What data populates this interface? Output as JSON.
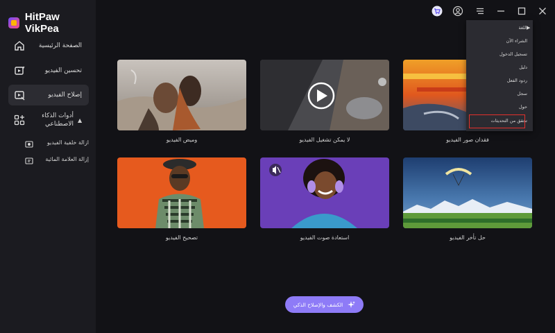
{
  "app": {
    "name": "HitPaw VikPea"
  },
  "sidebar": {
    "items": [
      {
        "label": "الصفحة الرئيسية",
        "icon": "home-icon"
      },
      {
        "label": "تحسين الفيديو",
        "icon": "video-enhance-icon"
      },
      {
        "label": "إصلاح الفيديو",
        "icon": "video-repair-icon"
      },
      {
        "label": "أدوات الذكاء الاصطناعي",
        "icon": "ai-tools-icon"
      }
    ],
    "subitems": [
      {
        "label": "ازالة خلفية الفيديو",
        "icon": "remove-background-icon"
      },
      {
        "label": "إزالة العلامة المائية",
        "icon": "remove-watermark-icon"
      }
    ]
  },
  "cards": [
    {
      "label": "وميض الفيديو"
    },
    {
      "label": "لا يمكن تشغيل الفيديو"
    },
    {
      "label": "فقدان صور الفيديو"
    },
    {
      "label": "تصحيح الفيديو"
    },
    {
      "label": "استعادة صوت الفيديو"
    },
    {
      "label": "حل تأخر الفيديو"
    }
  ],
  "menu": {
    "items": [
      {
        "label": "اللغة"
      },
      {
        "label": "الشراء الآن"
      },
      {
        "label": "تسجيل الدخول"
      },
      {
        "label": "دليل"
      },
      {
        "label": "ردود الفعل"
      },
      {
        "label": "سجل"
      },
      {
        "label": "حول"
      },
      {
        "label": "تحقق من التحديثات"
      }
    ]
  },
  "fix_button": {
    "label": "الكشف والإصلاح الذكي"
  },
  "colors": {
    "accent": "#8e7bf7",
    "highlight": "#e4312b",
    "sidebar": "#1b1b20",
    "background": "#121216"
  }
}
